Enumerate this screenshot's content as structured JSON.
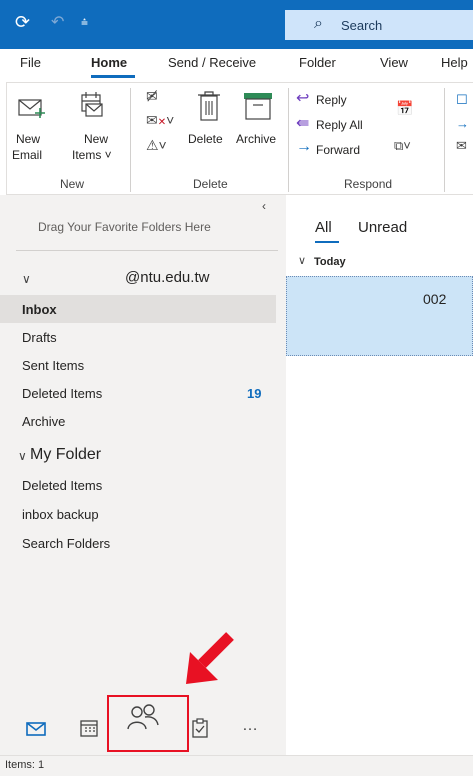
{
  "titlebar": {
    "search_placeholder": "Search",
    "accent": "#0f6cbd"
  },
  "menu": {
    "tabs": [
      "File",
      "Home",
      "Send / Receive",
      "Folder",
      "View",
      "Help"
    ]
  },
  "ribbon": {
    "new_email": [
      "New",
      "Email"
    ],
    "new_items": [
      "New",
      "Items ˅"
    ],
    "delete": "Delete",
    "archive": "Archive",
    "reply": "Reply",
    "reply_all": "Reply All",
    "forward": "Forward",
    "groups": {
      "new": "New",
      "delete": "Delete",
      "respond": "Respond"
    }
  },
  "sidebar": {
    "favorites_hint": "Drag Your Favorite Folders Here",
    "account": "@ntu.edu.tw",
    "folders": [
      {
        "label": "Inbox",
        "count": ""
      },
      {
        "label": "Drafts",
        "count": ""
      },
      {
        "label": "Sent Items",
        "count": ""
      },
      {
        "label": "Deleted Items",
        "count": "19"
      },
      {
        "label": "Archive",
        "count": ""
      }
    ],
    "my_folder": {
      "label": "My Folder",
      "items": [
        "Deleted Items",
        "inbox backup",
        "Search Folders"
      ]
    }
  },
  "list": {
    "filters": [
      "All",
      "Unread"
    ],
    "group": "Today",
    "message_preview": "002"
  },
  "status": {
    "text": "Items: 1"
  }
}
